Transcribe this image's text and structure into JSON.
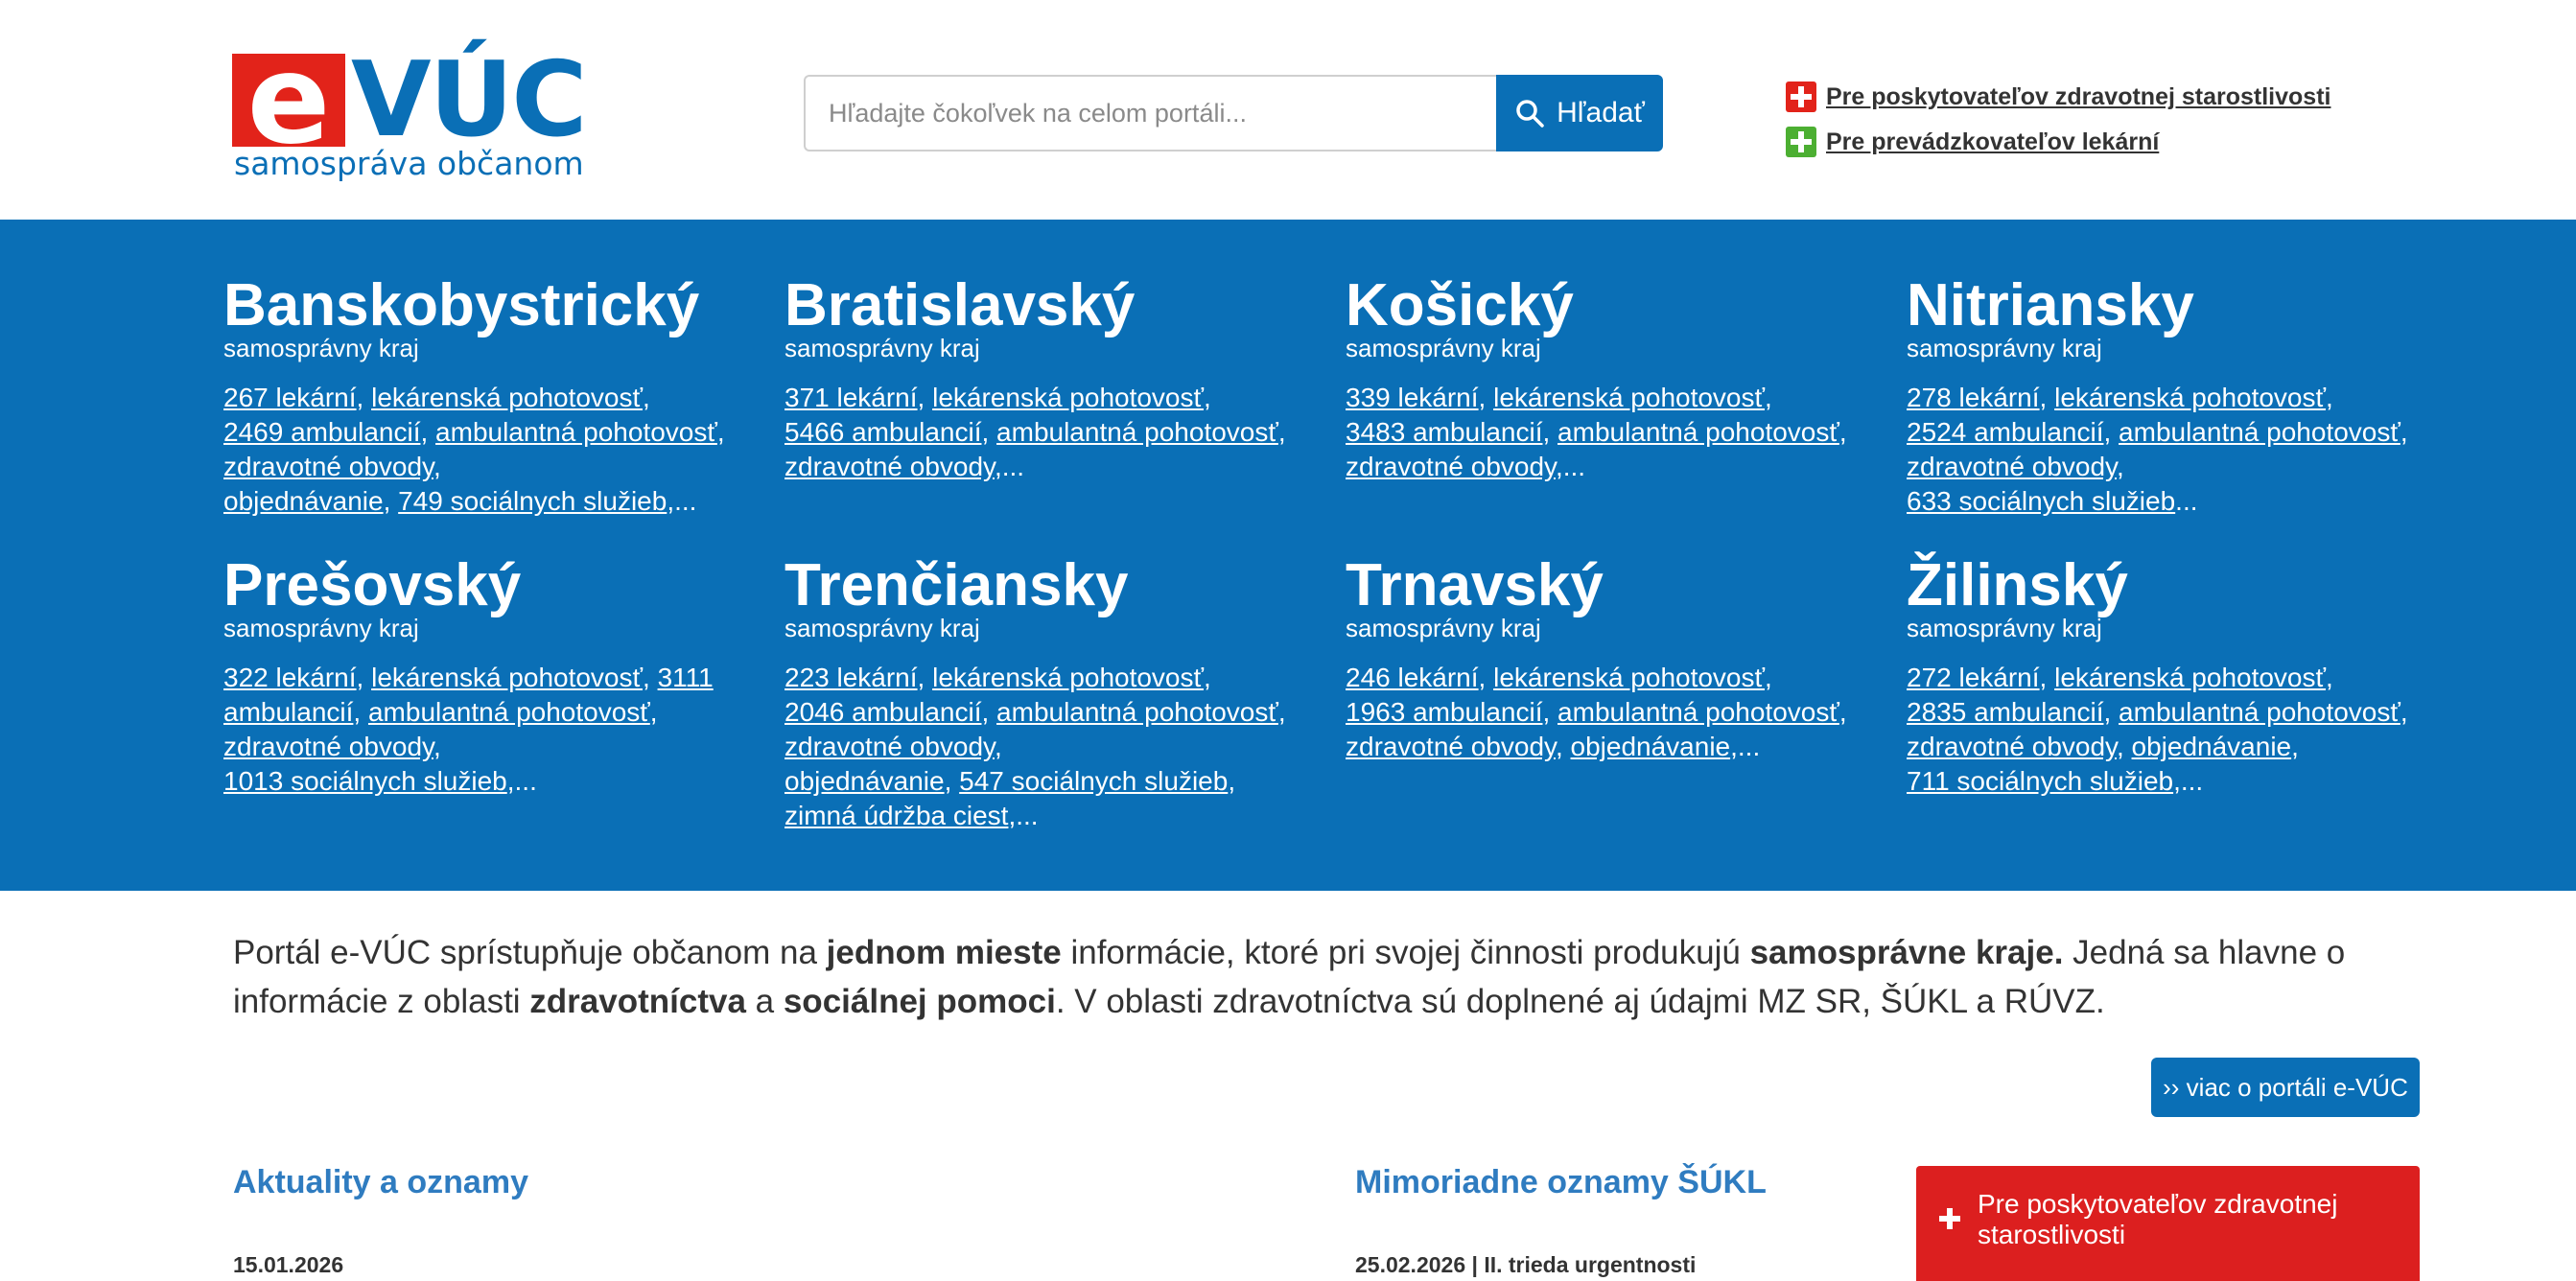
{
  "brand": {
    "logo_e": "e",
    "logo_word": "VÚC",
    "tagline": "samospráva občanom"
  },
  "search": {
    "placeholder": "Hľadajte čokoľvek na celom portáli...",
    "button_label": "Hľadať"
  },
  "top_links": [
    {
      "label": "Pre poskytovateľov zdravotnej starostlivosti",
      "icon": "red-cross-icon"
    },
    {
      "label": "Pre prevádzkovateľov lekární",
      "icon": "green-cross-icon"
    }
  ],
  "regions": [
    {
      "name": "Banskobystrický",
      "subtitle": "samosprávny kraj",
      "links": [
        "267 lekární",
        "lekárenská pohotovosť",
        "2469 ambulancií",
        "ambulantná pohotovosť",
        "zdravotné obvody",
        "objednávanie",
        "749 sociálnych služieb"
      ]
    },
    {
      "name": "Bratislavský",
      "subtitle": "samosprávny kraj",
      "links": [
        "371 lekární",
        "lekárenská pohotovosť",
        "5466 ambulancií",
        "ambulantná pohotovosť",
        "zdravotné obvody"
      ]
    },
    {
      "name": "Košický",
      "subtitle": "samosprávny kraj",
      "links": [
        "339 lekární",
        "lekárenská pohotovosť",
        "3483 ambulancií",
        "ambulantná pohotovosť",
        "zdravotné obvody"
      ]
    },
    {
      "name": "Nitriansky",
      "subtitle": "samosprávny kraj",
      "links": [
        "278 lekární",
        "lekárenská pohotovosť",
        "2524 ambulancií",
        "ambulantná pohotovosť",
        "zdravotné obvody",
        "633 sociálnych služieb"
      ]
    },
    {
      "name": "Prešovský",
      "subtitle": "samosprávny kraj",
      "links": [
        "322 lekární",
        "lekárenská pohotovosť",
        "3111 ambulancií",
        "ambulantná pohotovosť",
        "zdravotné obvody",
        "1013 sociálnych služieb"
      ]
    },
    {
      "name": "Trenčiansky",
      "subtitle": "samosprávny kraj",
      "links": [
        "223 lekární",
        "lekárenská pohotovosť",
        "2046 ambulancií",
        "ambulantná pohotovosť",
        "zdravotné obvody",
        "objednávanie",
        "547 sociálnych služieb",
        "zimná údržba ciest"
      ]
    },
    {
      "name": "Trnavský",
      "subtitle": "samosprávny kraj",
      "links": [
        "246 lekární",
        "lekárenská pohotovosť",
        "1963 ambulancií",
        "ambulantná pohotovosť",
        "zdravotné obvody",
        "objednávanie"
      ]
    },
    {
      "name": "Žilinský",
      "subtitle": "samosprávny kraj",
      "links": [
        "272 lekární",
        "lekárenská pohotovosť",
        "2835 ambulancií",
        "ambulantná pohotovosť",
        "zdravotné obvody",
        "objednávanie",
        "711 sociálnych služieb"
      ]
    }
  ],
  "intro": {
    "p1": "Portál e-VÚC sprístupňuje občanom na ",
    "b1": "jednom mieste",
    "p2": " informácie, ktoré pri svojej činnosti produkujú ",
    "b2": "samosprávne kraje.",
    "p3": " Jedná sa hlavne o informácie z oblasti ",
    "b3": "zdravotníctva",
    "p4": " a ",
    "b4": "sociálnej pomoci",
    "p5": ". V oblasti zdravotníctva sú doplnené aj údajmi MZ SR, ŠÚKL a RÚVZ."
  },
  "more_button": "›› viac o portáli e-VÚC",
  "news": {
    "title": "Aktuality a oznamy",
    "first_date": "15.01.2026"
  },
  "sukl": {
    "title": "Mimoriadne oznamy ŠÚKL",
    "first_item": "25.02.2026 | II. trieda urgentnosti"
  },
  "provider_card": {
    "label": "Pre poskytovateľov zdravotnej starostlivosti"
  },
  "colors": {
    "primary_blue": "#0a6fb6",
    "brand_red": "#e2231a",
    "brand_green": "#4caf32",
    "card_red": "#dc1f1f",
    "heading_blue": "#2f7cc0"
  }
}
